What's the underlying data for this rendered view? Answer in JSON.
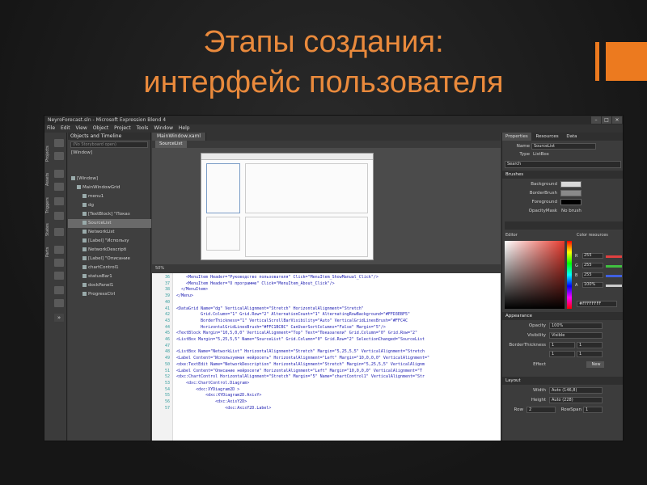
{
  "slide": {
    "title_line1": "Этапы создания:",
    "title_line2": "интерфейс пользователя",
    "accent_color": "#ec7a1f",
    "title_color": "#ea8a3c"
  },
  "window": {
    "title": "NeyroForecast.sln - Microsoft Expression Blend 4",
    "menu": [
      "File",
      "Edit",
      "View",
      "Object",
      "Project",
      "Tools",
      "Window",
      "Help"
    ],
    "controls": [
      "–",
      "□",
      "×"
    ]
  },
  "toolbox": {
    "vertical_tabs": [
      "Projects",
      "Assets",
      "Triggers",
      "States",
      "Parts"
    ]
  },
  "objects_panel": {
    "title": "Objects and Timeline",
    "search_placeholder": "(No Storyboard open)",
    "root": "[Window]",
    "items": [
      {
        "label": "[Window]",
        "depth": 0
      },
      {
        "label": "MainWindowGrid",
        "depth": 1
      },
      {
        "label": "menu1",
        "depth": 2
      },
      {
        "label": "dg",
        "depth": 2
      },
      {
        "label": "[TextBlock] \"Показ",
        "depth": 2
      },
      {
        "label": "SourceList",
        "depth": 2,
        "selected": true
      },
      {
        "label": "NetworkList",
        "depth": 2
      },
      {
        "label": "[Label] \"Использу",
        "depth": 2
      },
      {
        "label": "NetworkDescripti",
        "depth": 2
      },
      {
        "label": "[Label] \"Описание",
        "depth": 2
      },
      {
        "label": "chartControl1",
        "depth": 2
      },
      {
        "label": "statusBar1",
        "depth": 2
      },
      {
        "label": "dockPanel1",
        "depth": 2
      },
      {
        "label": "ProgressCtrl",
        "depth": 2
      }
    ]
  },
  "document": {
    "tab": "MainWindow.xaml",
    "breadcrumb": "SourceList",
    "zoom": "50%",
    "code_lines": [
      {
        "n": "36",
        "t": "    <MenuItem Header=\"Руководство пользователя\" Click=\"MenuItem_ShowManual_Click\"/>"
      },
      {
        "n": "37",
        "t": "    <MenuItem Header=\"О программе\" Click=\"MenuItem_About_Click\"/>"
      },
      {
        "n": "38",
        "t": "  </MenuItem>"
      },
      {
        "n": "39",
        "t": "</Menu>"
      },
      {
        "n": "40",
        "t": ""
      },
      {
        "n": "41",
        "t": "<DataGrid Name=\"dg\" VerticalAlignment=\"Stretch\" HorizontalAlignment=\"Stretch\""
      },
      {
        "n": "42",
        "t": "          Grid.Column=\"1\" Grid.Row=\"2\" AlternationCount=\"1\" AlternatingRowBackground=\"#FFD3EBF5\""
      },
      {
        "n": "43",
        "t": "          BorderThickness=\"1\" VerticalScrollBarVisibility=\"Auto\" VerticalGridLinesBrush=\"#FFC4C"
      },
      {
        "n": "44",
        "t": "          HorizontalGridLinesBrush=\"#FFC1BCBC\" CanUserSortColumns=\"False\" Margin=\"5\"/>"
      },
      {
        "n": "45",
        "t": "<TextBlock Margin=\"10,5,0,0\" VerticalAlignment=\"Top\" Text=\"Показатели\" Grid.Column=\"0\" Grid.Row=\"2\""
      },
      {
        "n": "46",
        "t": "<ListBox Margin=\"5,25,5,5\" Name=\"SourceList\" Grid.Column=\"0\" Grid.Row=\"2\" SelectionChanged=\"SourceList"
      },
      {
        "n": "47",
        "t": ""
      },
      {
        "n": "48",
        "t": "<ListBox Name=\"NetworkList\" HorizontalAlignment=\"Stretch\" Margin=\"5,25,5,5\" VerticalAlignment=\"Stretch"
      },
      {
        "n": "49",
        "t": "<Label Content=\"Используемая нейросеть\" HorizontalAlignment=\"Left\" Margin=\"10,0,0,0\" VerticalAlignment=\""
      },
      {
        "n": "50",
        "t": "<dxe:TextEdit Name=\"NetworkDescription\" HorizontalAlignment=\"Stretch\" Margin=\"5,25,5,5\" VerticalAlignm"
      },
      {
        "n": "51",
        "t": "<Label Content=\"Описание нейросети\" HorizontalAlignment=\"Left\" Margin=\"10,0,0,0\" VerticalAlignment=\"T"
      },
      {
        "n": "52",
        "t": "<dxc:ChartControl HorizontalAlignment=\"Stretch\" Margin=\"5\" Name=\"chartControl1\" VerticalAlignment=\"Str"
      },
      {
        "n": "53",
        "t": "    <dxc:ChartControl.Diagram>"
      },
      {
        "n": "54",
        "t": "        <dxc:XYDiagram2D >"
      },
      {
        "n": "55",
        "t": "            <dxc:XYDiagram2D.AxisY>"
      },
      {
        "n": "56",
        "t": "                <dxc:AxisY2D>"
      },
      {
        "n": "57",
        "t": "                    <dxc:AxisY2D.Label>"
      }
    ]
  },
  "properties": {
    "tabs": [
      "Properties",
      "Resources",
      "Data"
    ],
    "name_label": "Name",
    "name_value": "SourceList",
    "type_label": "Type",
    "type_value": "ListBox",
    "search_placeholder": "Search",
    "brushes_title": "Brushes",
    "brushes": [
      {
        "label": "Background",
        "color": "#d9d9d9"
      },
      {
        "label": "BorderBrush",
        "color": "#8a8a8a"
      },
      {
        "label": "Foreground",
        "color": "#000000"
      },
      {
        "label": "OpacityMask",
        "value": "No brush"
      }
    ],
    "editor_label": "Editor",
    "color_resources_label": "Color resources",
    "rgb": [
      {
        "k": "R",
        "v": "255",
        "c": "#e04040"
      },
      {
        "k": "G",
        "v": "255",
        "c": "#40c040"
      },
      {
        "k": "B",
        "v": "255",
        "c": "#4060e0"
      },
      {
        "k": "A",
        "v": "100%",
        "c": "#cccccc"
      }
    ],
    "hex_value": "#FFFFFFFF",
    "appearance_title": "Appearance",
    "opacity_label": "Opacity",
    "opacity_value": "100%",
    "visibility_label": "Visibility",
    "visibility_value": "Visible",
    "border_label": "BorderThickness",
    "border_values": [
      "1",
      "1",
      "1",
      "1"
    ],
    "effect_label": "Effect",
    "new_label": "New",
    "layout_title": "Layout",
    "width_label": "Width",
    "width_value": "Auto (146,8)",
    "height_label": "Height",
    "height_value": "Auto (228)",
    "row_label": "Row",
    "row_value": "2",
    "rowspan_label": "RowSpan",
    "rowspan_value": "1"
  }
}
